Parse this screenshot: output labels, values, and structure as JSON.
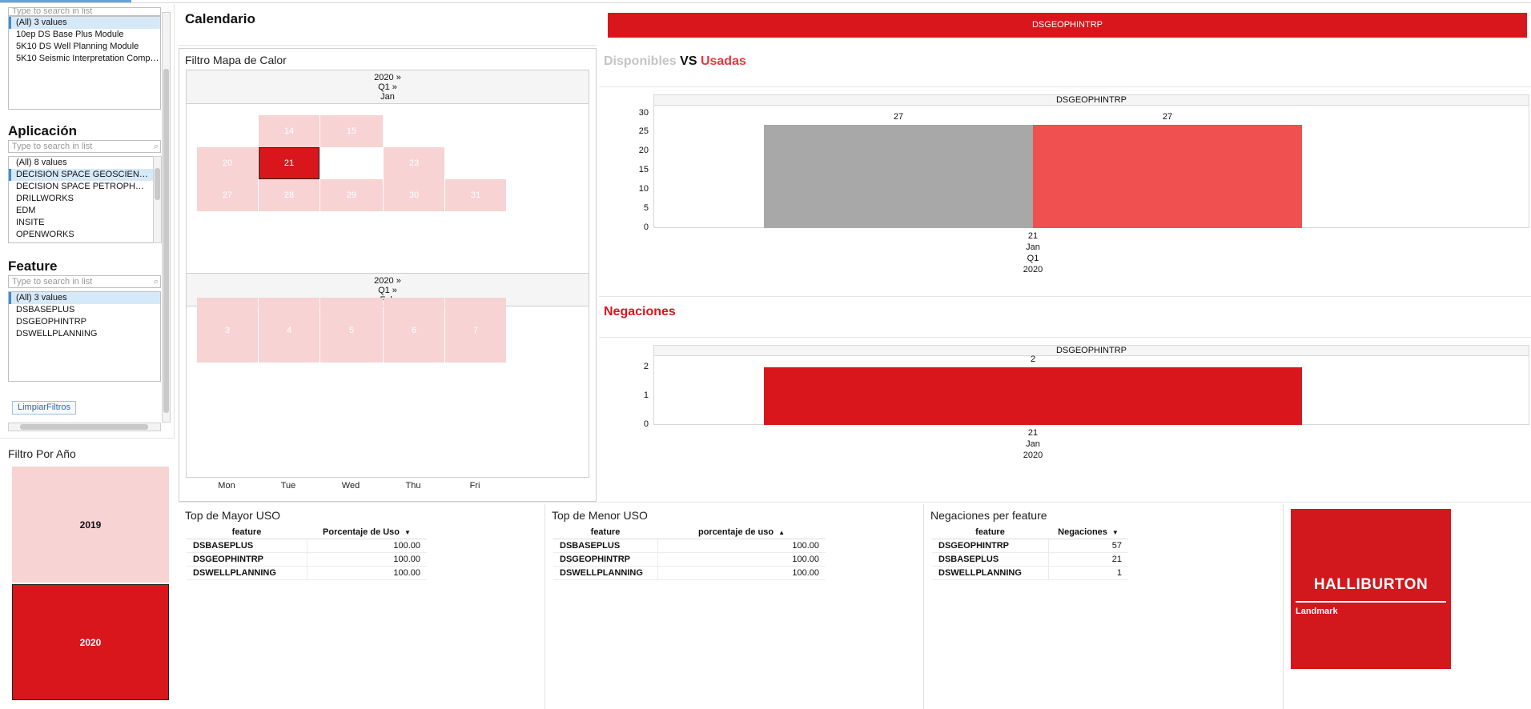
{
  "colors": {
    "accent_red": "#d8161c",
    "light_red": "#f7d3d3",
    "usadas_red": "#f05050",
    "disponibles_gray": "#a8a8a8",
    "selection_blue": "#d6e9f9"
  },
  "filters": {
    "top_search_placeholder": "Type to search in list",
    "top_list": [
      {
        "label": "(All) 3 values",
        "selected": true
      },
      {
        "label": "10ep DS Base Plus Module",
        "selected": false
      },
      {
        "label": "5K10 DS Well Planning Module",
        "selected": false
      },
      {
        "label": "5K10 Seismic Interpretation Comp…",
        "selected": false
      }
    ],
    "aplicacion": {
      "title": "Aplicación",
      "placeholder": "Type to search in list",
      "items": [
        {
          "label": "(All) 8 values",
          "selected": false
        },
        {
          "label": "DECISION SPACE GEOSCIEN…",
          "selected": true
        },
        {
          "label": "DECISION SPACE PETROPH…",
          "selected": false
        },
        {
          "label": "DRILLWORKS",
          "selected": false
        },
        {
          "label": "EDM",
          "selected": false
        },
        {
          "label": "INSITE",
          "selected": false
        },
        {
          "label": "OPENWORKS",
          "selected": false
        }
      ]
    },
    "feature": {
      "title": "Feature",
      "placeholder": "Type to search in list",
      "items": [
        {
          "label": "(All) 3 values",
          "selected": true
        },
        {
          "label": "DSBASEPLUS",
          "selected": false
        },
        {
          "label": "DSGEOPHINTRP",
          "selected": false
        },
        {
          "label": "DSWELLPLANNING",
          "selected": false
        }
      ]
    },
    "clear_button": "LimpiarFiltros",
    "search_icon": "magnifier-icon"
  },
  "year_filter": {
    "title": "Filtro Por Año",
    "years": [
      {
        "label": "2019",
        "selected": false
      },
      {
        "label": "2020",
        "selected": true
      }
    ]
  },
  "calendar": {
    "section_title": "Calendario",
    "panel_title": "Filtro Mapa de Calor",
    "months": [
      {
        "year": "2020 »",
        "quarter": "Q1 »",
        "month": "Jan",
        "rows": [
          [
            {
              "d": "",
              "c": 0
            },
            {
              "d": "14",
              "c": 1
            },
            {
              "d": "15",
              "c": 1
            },
            {
              "d": "",
              "c": 0
            },
            {
              "d": "",
              "c": 0
            }
          ],
          [
            {
              "d": "20",
              "c": 1
            },
            {
              "d": "21",
              "c": 2
            },
            {
              "d": "",
              "c": 0
            },
            {
              "d": "23",
              "c": 1
            },
            {
              "d": "",
              "c": 0
            }
          ],
          [
            {
              "d": "27",
              "c": 1
            },
            {
              "d": "28",
              "c": 1
            },
            {
              "d": "29",
              "c": 1
            },
            {
              "d": "30",
              "c": 1
            },
            {
              "d": "31",
              "c": 1
            }
          ]
        ]
      },
      {
        "year": "2020 »",
        "quarter": "Q1 »",
        "month": "Feb",
        "rows": [
          [
            {
              "d": "3",
              "c": 1
            },
            {
              "d": "4",
              "c": 1
            },
            {
              "d": "5",
              "c": 1
            },
            {
              "d": "6",
              "c": 1
            },
            {
              "d": "7",
              "c": 1
            }
          ]
        ]
      }
    ],
    "weekdays": [
      "Mon",
      "Tue",
      "Wed",
      "Thu",
      "Fri"
    ]
  },
  "banner": {
    "label": "DSGEOPHINTRP"
  },
  "dvu": {
    "title_parts": [
      "Disponibles",
      "VS",
      "Usadas"
    ]
  },
  "negaciones": {
    "title": "Negaciones"
  },
  "chart_data": [
    {
      "type": "bar",
      "title": "Disponibles VS Usadas",
      "panel_header": "DSGEOPHINTRP",
      "categories": [
        "21"
      ],
      "x_hierarchy": [
        "21",
        "Jan",
        "Q1",
        "2020"
      ],
      "series": [
        {
          "name": "Disponibles",
          "values": [
            27
          ],
          "color": "#a8a8a8"
        },
        {
          "name": "Usadas",
          "values": [
            27
          ],
          "color": "#f05050"
        }
      ],
      "yticks": [
        "30",
        "25",
        "20",
        "15",
        "10",
        "5",
        "0"
      ],
      "ylim": [
        0,
        32
      ],
      "data_labels": [
        "27",
        "27"
      ]
    },
    {
      "type": "bar",
      "title": "Negaciones",
      "panel_header": "DSGEOPHINTRP",
      "categories": [
        "21"
      ],
      "x_hierarchy": [
        "21",
        "Jan",
        "2020"
      ],
      "series": [
        {
          "values": [
            2
          ],
          "color": "#d8161c"
        }
      ],
      "yticks": [
        "2",
        "1",
        "0"
      ],
      "ylim": [
        0,
        2.4
      ],
      "data_labels": [
        "2"
      ]
    }
  ],
  "tables": {
    "mayor": {
      "title": "Top de Mayor USO",
      "headers": [
        "feature",
        "Porcentaje de Uso"
      ],
      "sort": "▼",
      "rows": [
        [
          "DSBASEPLUS",
          "100.00"
        ],
        [
          "DSGEOPHINTRP",
          "100.00"
        ],
        [
          "DSWELLPLANNING",
          "100.00"
        ]
      ]
    },
    "menor": {
      "title": "Top de Menor USO",
      "headers": [
        "feature",
        "porcentaje de uso"
      ],
      "sort": "▲",
      "rows": [
        [
          "DSBASEPLUS",
          "100.00"
        ],
        [
          "DSGEOPHINTRP",
          "100.00"
        ],
        [
          "DSWELLPLANNING",
          "100.00"
        ]
      ]
    },
    "negaciones": {
      "title": "Negaciones per feature",
      "headers": [
        "feature",
        "Negaciones"
      ],
      "sort": "▼",
      "rows": [
        [
          "DSGEOPHINTRP",
          "57"
        ],
        [
          "DSBASEPLUS",
          "21"
        ],
        [
          "DSWELLPLANNING",
          "1"
        ]
      ]
    }
  },
  "logo": {
    "brand": "HALLIBURTON",
    "sub": "Landmark"
  }
}
